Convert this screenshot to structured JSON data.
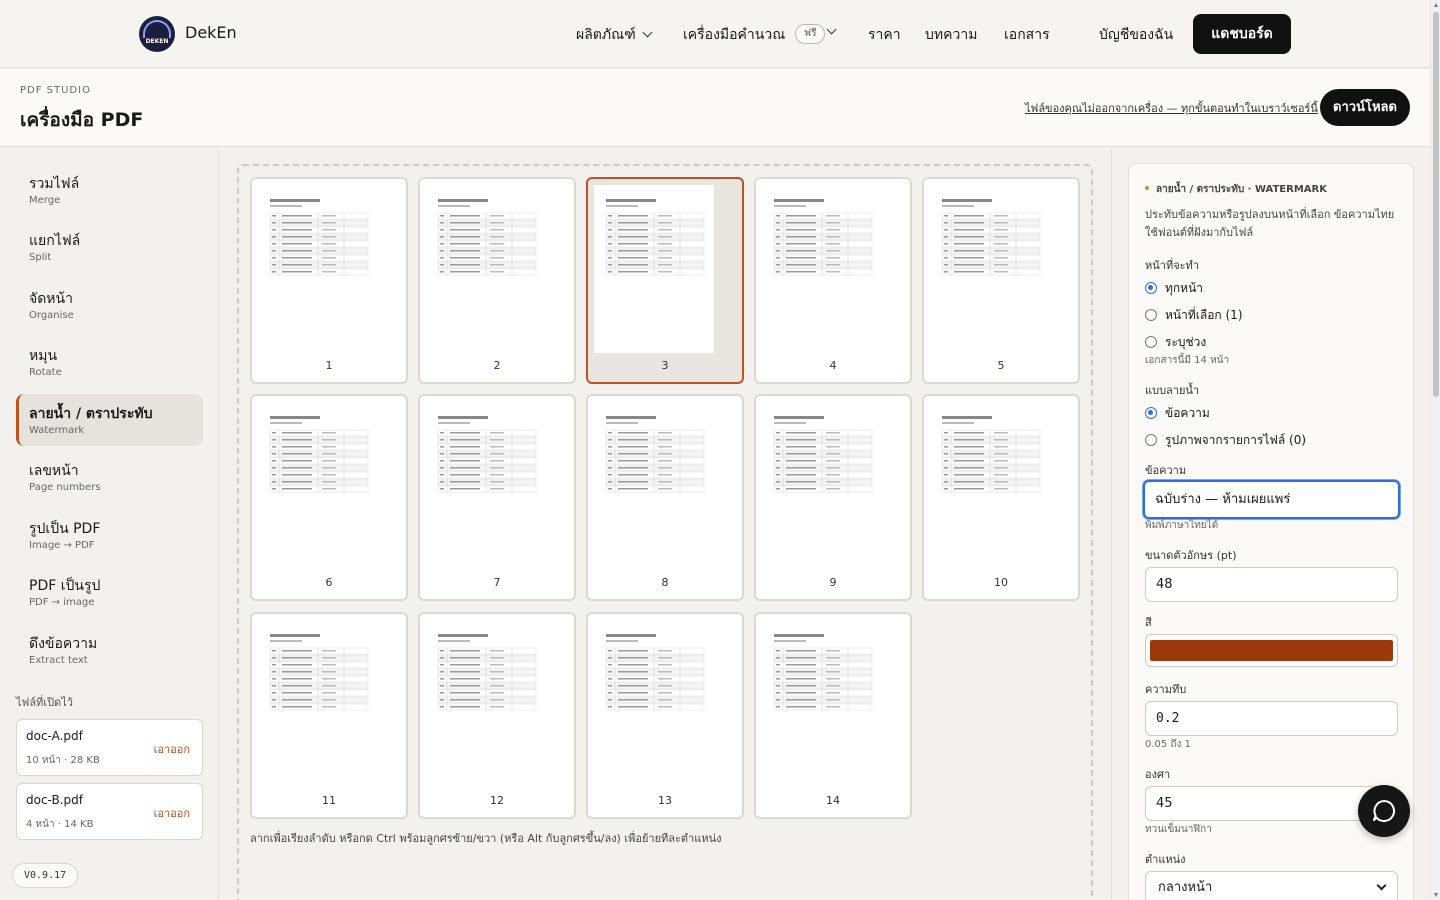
{
  "nav": {
    "brand": "DekEn",
    "logo_text": "DEKEN",
    "products": "ผลิตภัณฑ์",
    "calculators": "เครื่องมือคำนวณ",
    "free_badge": "ฟรี",
    "pricing": "ราคา",
    "articles": "บทความ",
    "docs": "เอกสาร",
    "account": "บัญชีของฉัน",
    "dashboard": "แดชบอร์ด"
  },
  "header": {
    "eyebrow": "PDF STUDIO",
    "title": "เครื่องมือ PDF",
    "privacy_note": "ไฟล์ของคุณไม่ออกจากเครื่อง — ทุกขั้นตอนทำในเบราว์เซอร์นี้",
    "download": "ดาวน์โหลด"
  },
  "sidebar": {
    "tools": [
      {
        "th": "รวมไฟล์",
        "en": "Merge"
      },
      {
        "th": "แยกไฟล์",
        "en": "Split"
      },
      {
        "th": "จัดหน้า",
        "en": "Organise"
      },
      {
        "th": "หมุน",
        "en": "Rotate"
      },
      {
        "th": "ลายน้ำ / ตราประทับ",
        "en": "Watermark"
      },
      {
        "th": "เลขหน้า",
        "en": "Page numbers"
      },
      {
        "th": "รูปเป็น PDF",
        "en": "Image → PDF"
      },
      {
        "th": "PDF เป็นรูป",
        "en": "PDF → image"
      },
      {
        "th": "ดึงข้อความ",
        "en": "Extract text"
      }
    ],
    "active_tool_index": 4,
    "open_files_heading": "ไฟล์ที่เปิดไว้",
    "files": [
      {
        "name": "doc-A.pdf",
        "meta": "10 หน้า · 28 KB",
        "remove": "เอาออก"
      },
      {
        "name": "doc-B.pdf",
        "meta": "4 หน้า · 14 KB",
        "remove": "เอาออก"
      }
    ],
    "version": "V0.9.17"
  },
  "pages": {
    "numbers": [
      "1",
      "2",
      "3",
      "4",
      "5",
      "6",
      "7",
      "8",
      "9",
      "10",
      "11",
      "12",
      "13",
      "14"
    ],
    "selected": "3",
    "hint": "ลากเพื่อเรียงลำดับ หรือกด Ctrl พร้อมลูกศรซ้าย/ขวา (หรือ Alt กับลูกศรขึ้น/ลง) เพื่อย้ายทีละตำแหน่ง"
  },
  "panel": {
    "heading": "ลายน้ำ / ตราประทับ · WATERMARK",
    "description": "ประทับข้อความหรือรูปลงบนหน้าที่เลือก ข้อความไทยใช้ฟอนต์ที่ฝังมากับไฟล์",
    "pages_label": "หน้าที่จะทำ",
    "page_options": [
      "ทุกหน้า",
      "หน้าที่เลือก (1)",
      "ระบุช่วง"
    ],
    "page_option_selected": 0,
    "page_count_note": "เอกสารนี้มี 14 หน้า",
    "type_label": "แบบลายน้ำ",
    "type_options": [
      "ข้อความ",
      "รูปภาพจากรายการไฟล์ (0)"
    ],
    "type_option_selected": 0,
    "text_label": "ข้อความ",
    "text_value": "ฉบับร่าง — ห้ามเผยแพร่",
    "text_hint": "พิมพ์ภาษาไทยได้",
    "size_label": "ขนาดตัวอักษร (pt)",
    "size_value": "48",
    "color_label": "สี",
    "color_value": "#9c3a0e",
    "opacity_label": "ความทึบ",
    "opacity_value": "0.2",
    "opacity_range": "0.05 ถึง 1",
    "angle_label": "องศา",
    "angle_value": "45",
    "angle_hint": "ทวนเข็มนาฬิกา",
    "position_label": "ตำแหน่ง",
    "position_value": "กลางหน้า"
  },
  "colors": {
    "accent": "#c0521d",
    "focus": "#2a6fdb",
    "dark": "#111111"
  }
}
